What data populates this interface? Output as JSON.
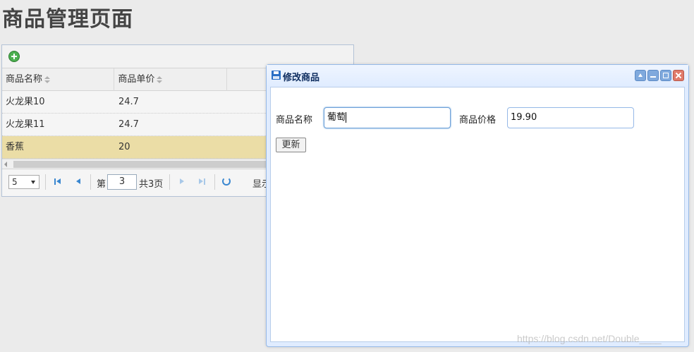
{
  "page": {
    "title": "商品管理页面"
  },
  "grid": {
    "columns": [
      "商品名称",
      "商品单价"
    ],
    "rows": [
      {
        "name": "火龙果10",
        "price": "24.7",
        "selected": false
      },
      {
        "name": "火龙果11",
        "price": "24.7",
        "selected": false
      },
      {
        "name": "香蕉",
        "price": "20",
        "selected": true
      }
    ],
    "pager": {
      "page_size": "5",
      "page_prefix": "第",
      "current_page": "3",
      "total_pages_text": "共3页",
      "display_text": "显示"
    }
  },
  "dialog": {
    "title": "修改商品",
    "name_label": "商品名称",
    "name_value": "葡萄",
    "price_label": "商品价格",
    "price_value": "19.90",
    "update_label": "更新"
  },
  "watermark": "https://blog.csdn.net/Double____"
}
